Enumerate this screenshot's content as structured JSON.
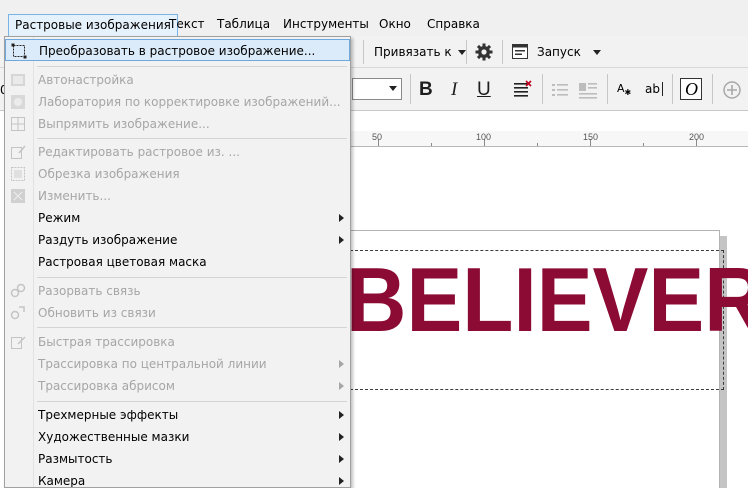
{
  "menubar": {
    "items": [
      {
        "label": "Растровые изображения",
        "active": true
      },
      {
        "label": "Текст"
      },
      {
        "label": "Таблица"
      },
      {
        "label": "Инструменты"
      },
      {
        "label": "Окно"
      },
      {
        "label": "Справка"
      }
    ]
  },
  "toolbar": {
    "snap_label": "Привязать к",
    "launch_label": "Запуск",
    "font_size_value": "",
    "bold": "B",
    "italic": "I",
    "underline": "U",
    "char_a": "A",
    "char_ab": "ab",
    "char_o": "O",
    "left_stub": "0"
  },
  "ruler": {
    "labels": [
      "50",
      "100",
      "150",
      "200"
    ]
  },
  "canvas": {
    "text": "BELIEVER",
    "text_color": "#8c0b35"
  },
  "menu": {
    "items": [
      {
        "label": "Преобразовать в растровое изображение...",
        "enabled": true,
        "highlighted": true,
        "icon": "convert-to-bitmap-icon"
      },
      {
        "label": "Автонастройка",
        "enabled": false,
        "icon": "auto-adjust-icon"
      },
      {
        "label": "Лаборатория по корректировке изображений...",
        "enabled": false,
        "icon": "image-adjustment-lab-icon"
      },
      {
        "label": "Выпрямить изображение...",
        "enabled": false,
        "icon": "straighten-image-icon"
      },
      {
        "label": "Редактировать растровое из. ...",
        "enabled": false,
        "icon": "edit-bitmap-icon"
      },
      {
        "label": "Обрезка изображения",
        "enabled": false,
        "icon": "crop-bitmap-icon"
      },
      {
        "label": "Изменить...",
        "enabled": false,
        "icon": "resample-icon"
      },
      {
        "label": "Режим",
        "enabled": true,
        "submenu": true
      },
      {
        "label": "Раздуть изображение",
        "enabled": true,
        "submenu": true
      },
      {
        "label": "Растровая цветовая маска",
        "enabled": true
      },
      {
        "label": "Разорвать связь",
        "enabled": false,
        "icon": "break-link-icon"
      },
      {
        "label": "Обновить из связи",
        "enabled": false,
        "icon": "update-link-icon"
      },
      {
        "label": "Быстрая трассировка",
        "enabled": false,
        "icon": "quick-trace-icon"
      },
      {
        "label": "Трассировка по центральной линии",
        "enabled": false,
        "submenu": true
      },
      {
        "label": "Трассировка абрисом",
        "enabled": false,
        "submenu": true
      },
      {
        "label": "Трехмерные эффекты",
        "enabled": true,
        "submenu": true
      },
      {
        "label": "Художественные мазки",
        "enabled": true,
        "submenu": true
      },
      {
        "label": "Размытость",
        "enabled": true,
        "submenu": true
      },
      {
        "label": "Камера",
        "enabled": true,
        "submenu": true
      }
    ]
  },
  "colors": {
    "menu_highlight": "#dcebfa",
    "menu_highlight_border": "#6fa8dc",
    "disabled_text": "#a6a6a6",
    "artwork": "#8c0b35"
  }
}
